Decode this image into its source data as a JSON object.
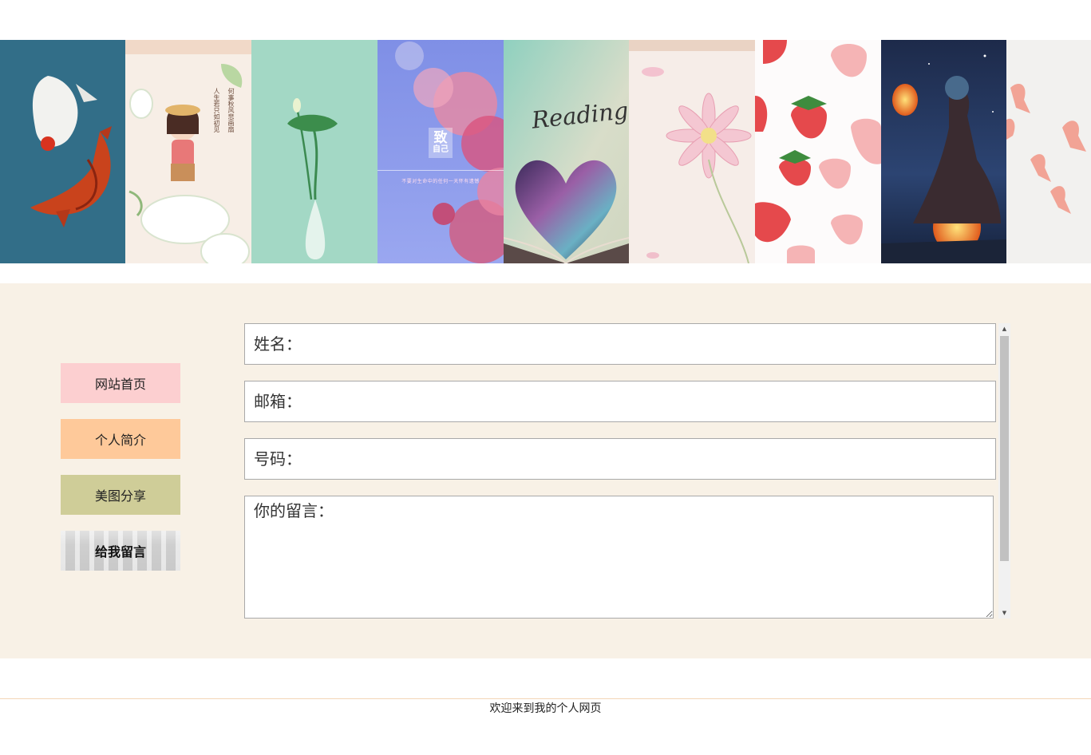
{
  "banner": {
    "panels": [
      {
        "name": "koi-fish"
      },
      {
        "name": "girl-in-flowers",
        "poem_left": "人生若只如初见",
        "poem_right": "何事秋风悲画扇"
      },
      {
        "name": "lotus-vase"
      },
      {
        "name": "cherry-blossom",
        "title_main": "致",
        "title_sub": "自己",
        "tagline": "不要对生命中的任何一天怀有遗憾"
      },
      {
        "name": "reading-book",
        "title": "Reading"
      },
      {
        "name": "pink-flower"
      },
      {
        "name": "strawberries"
      },
      {
        "name": "sky-lantern-girl"
      },
      {
        "name": "goldfish"
      }
    ]
  },
  "nav": {
    "home": "网站首页",
    "about": "个人简介",
    "gallery": "美图分享",
    "message": "给我留言"
  },
  "form": {
    "name_placeholder": "姓名：",
    "email_placeholder": "邮箱：",
    "phone_placeholder": "号码：",
    "message_placeholder": "你的留言："
  },
  "footer": {
    "text": "欢迎来到我的个人网页"
  },
  "colors": {
    "section_bg": "#f8f1e6",
    "nav_home": "#fccfd0",
    "nav_about": "#fec99a",
    "nav_gallery": "#cfcd98",
    "footer_line": "#f3d6b6"
  }
}
